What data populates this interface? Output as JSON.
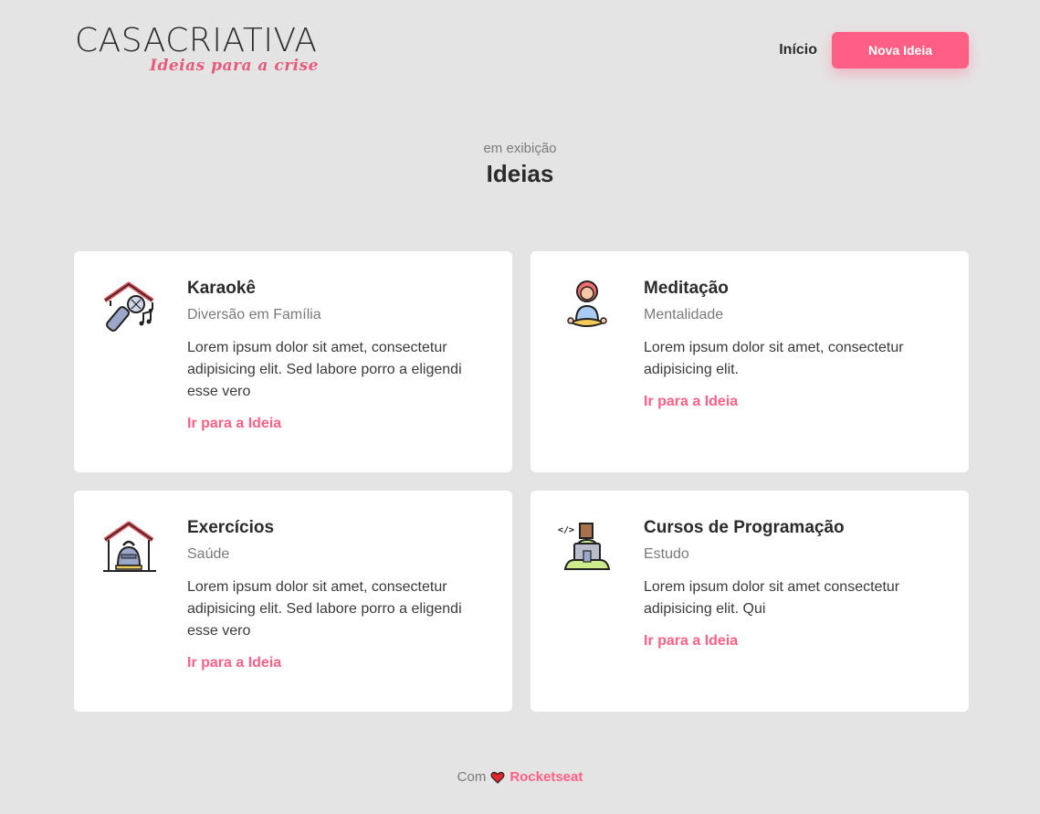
{
  "header": {
    "logo_bold": "CASA",
    "logo_light": "CRIATIVA",
    "logo_tagline": "Ideias para a crise",
    "nav_home": "Início",
    "nav_button": "Nova Ideia"
  },
  "intro": {
    "subtitle": "em exibição",
    "title": "Ideias"
  },
  "ideas": [
    {
      "icon": "karaoke-icon",
      "title": "Karaokê",
      "category": "Diversão em Família",
      "description": "Lorem ipsum dolor sit amet, consectetur adipisicing elit. Sed labore porro a eligendi esse vero",
      "link": "Ir para a Ideia"
    },
    {
      "icon": "meditation-icon",
      "title": "Meditação",
      "category": "Mentalidade",
      "description": "Lorem ipsum dolor sit amet, consectetur adipisicing elit.",
      "link": "Ir para a Ideia"
    },
    {
      "icon": "exercise-icon",
      "title": "Exercícios",
      "category": "Saúde",
      "description": "Lorem ipsum dolor sit amet, consectetur adipisicing elit. Sed labore porro a eligendi esse vero",
      "link": "Ir para a Ideia"
    },
    {
      "icon": "programming-icon",
      "title": "Cursos de Programação",
      "category": "Estudo",
      "description": "Lorem ipsum dolor sit amet consectetur adipisicing elit. Qui",
      "link": "Ir para a Ideia"
    }
  ],
  "footer": {
    "prefix": "Com",
    "brand": "Rocketseat"
  },
  "colors": {
    "background": "#e5e4e5",
    "accent": "#ff5f84",
    "text": "#2b2b2b"
  }
}
